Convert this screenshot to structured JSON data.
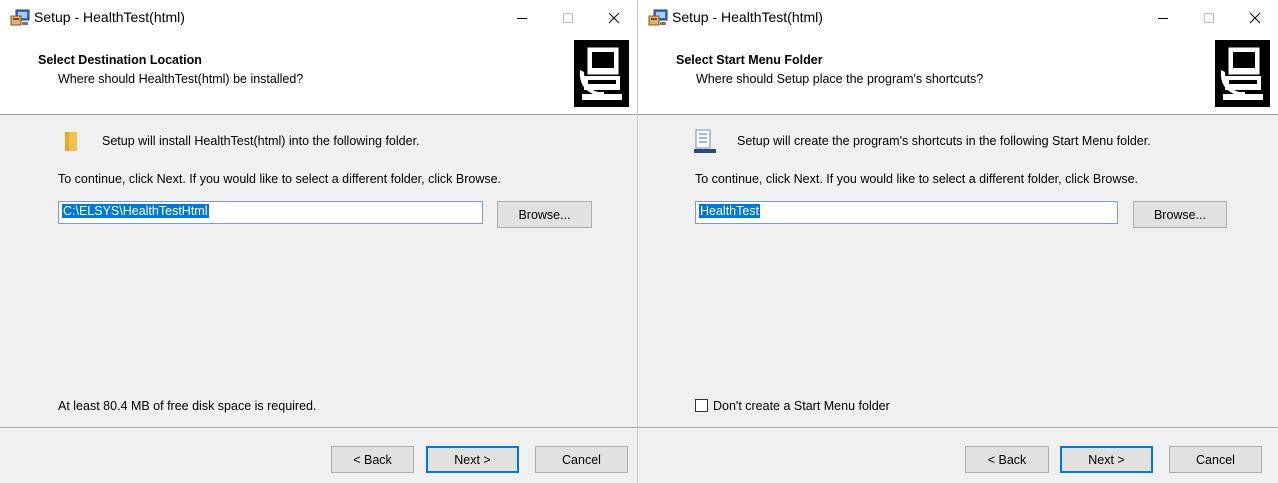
{
  "windows": [
    {
      "title": "Setup - HealthTest(html)",
      "header_title": "Select Destination Location",
      "header_subtitle": "Where should HealthTest(html) be installed?",
      "intro_text": "Setup will install HealthTest(html) into the following folder.",
      "instruction_text": "To continue, click Next. If you would like to select a different folder, click Browse.",
      "path_value": "C:\\ELSYS\\HealthTestHtml",
      "browse_label": "Browse...",
      "disk_space_text": "At least 80.4 MB of free disk space is required.",
      "back_label": "< Back",
      "next_label": "Next >",
      "cancel_label": "Cancel",
      "icon": "folder-icon"
    },
    {
      "title": "Setup - HealthTest(html)",
      "header_title": "Select Start Menu Folder",
      "header_subtitle": "Where should Setup place the program's shortcuts?",
      "intro_text": "Setup will create the program's shortcuts in the following Start Menu folder.",
      "instruction_text": "To continue, click Next. If you would like to select a different folder, click Browse.",
      "path_value": "HealthTest",
      "browse_label": "Browse...",
      "checkbox_label": "Don't create a Start Menu folder",
      "checkbox_checked": false,
      "back_label": "< Back",
      "next_label": "Next >",
      "cancel_label": "Cancel",
      "icon": "start-menu-shortcuts-icon"
    }
  ],
  "colors": {
    "selection": "#0078d7",
    "window_bg": "#f0f0f0",
    "header_bg": "#ffffff",
    "button_bg": "#e1e1e1"
  }
}
